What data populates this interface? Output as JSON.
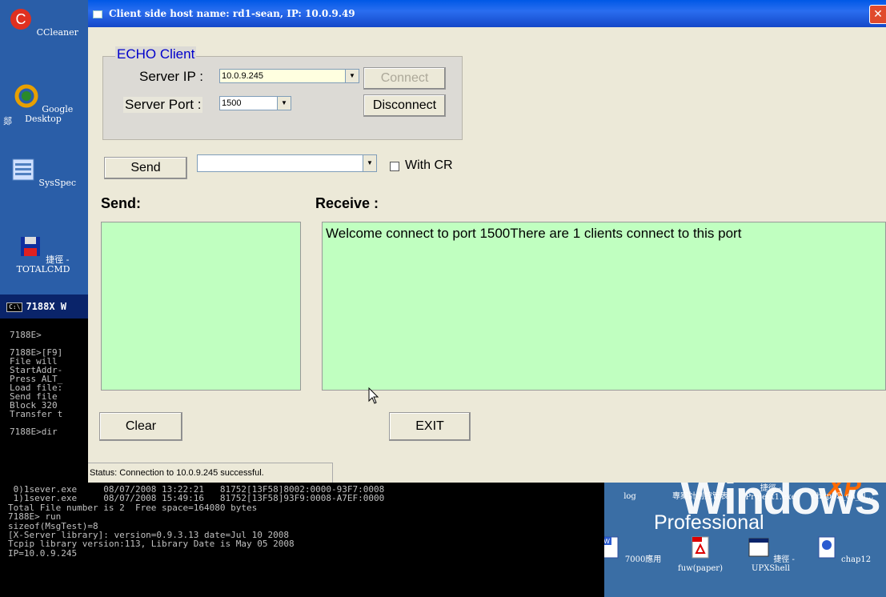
{
  "desktop": {
    "left_icons": [
      {
        "label": "CCleaner"
      },
      {
        "label": "Google Desktop"
      },
      {
        "label": "SysSpec"
      },
      {
        "label": "捷徑 - TOTALCMD"
      }
    ],
    "side_char": "郯"
  },
  "console": {
    "title": "7188X W",
    "cmd_badge": "C:\\",
    "left_lines": "\n7188E>\n\n7188E>[F9]\nFile will\nStartAddr-\nPress ALT_\nLoad file:\nSend file\nBlock 320\nTransfer t\n\n7188E>dir",
    "bottom_lines": " 0)1sever.exe     08/07/2008 13:22:21   81752[13F58]8002:0000-93F7:0008\n 1)1sever.exe     08/07/2008 15:49:16   81752[13F58]93F9:0008-A7EF:0000\nTotal File number is 2  Free space=164080 bytes\n7188E> run\nsizeof(MsgTest)=8\n[X-Server library]: version=0.9.3.13 date=Jul 10 2008\nTcpip library version:113, Library Date is May 05 2008\nIP=10.0.9.245"
  },
  "desktop_br": {
    "brand": "Windows",
    "brand_sub": "Professional",
    "brand_xp": "XP",
    "icons_top": [
      {
        "label": "log"
      },
      {
        "label": "專案計劃控管表"
      },
      {
        "label": "捷徑 - Project1.exe"
      },
      {
        "label": "chap05_ch_sl..."
      }
    ],
    "icons_bottom": [
      {
        "label": "7000應用"
      },
      {
        "label": "fuw(paper)"
      },
      {
        "label": "捷徑 - UPXShell"
      },
      {
        "label": "chap12"
      }
    ]
  },
  "window": {
    "title": "Client side host name: rd1-sean,   IP: 10.0.9.49",
    "close": "✕",
    "group_legend": "ECHO  Client",
    "server_ip_label": "Server IP :",
    "server_ip_value": "10.0.9.245",
    "server_port_label": "Server Port :",
    "server_port_value": "1500",
    "connect_label": "Connect",
    "disconnect_label": "Disconnect",
    "send_button": "Send",
    "send_combo_value": "",
    "with_cr_label": "With CR",
    "send_heading": "Send:",
    "receive_heading": "Receive :",
    "send_text": "",
    "receive_text": "Welcome connect to port 1500There are 1 clients connect to this port",
    "clear_label": "Clear",
    "exit_label": "EXIT",
    "status_text": "Status: Connection to 10.0.9.245 successful."
  }
}
